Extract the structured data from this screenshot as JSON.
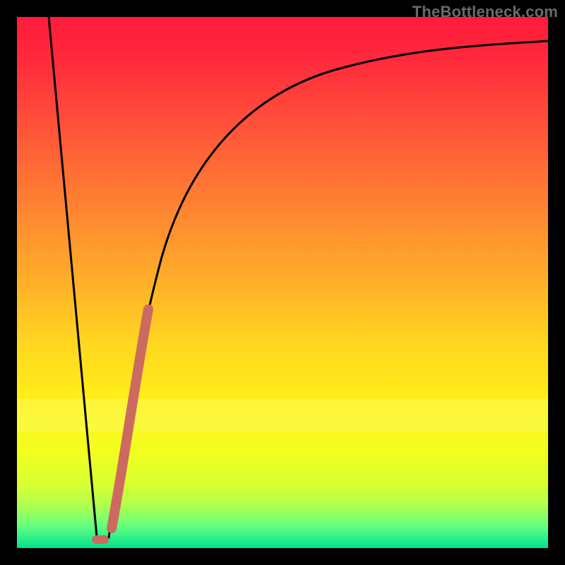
{
  "watermark": "TheBottleneck.com",
  "colors": {
    "background": "#000000",
    "curve": "#000000",
    "highlight": "#cc6a60"
  },
  "chart_data": {
    "type": "line",
    "title": "",
    "xlabel": "",
    "ylabel": "",
    "xlim": [
      0,
      100
    ],
    "ylim": [
      0,
      100
    ],
    "series": [
      {
        "name": "left-branch",
        "x": [
          5,
          8,
          11,
          14
        ],
        "values": [
          100,
          60,
          25,
          2
        ]
      },
      {
        "name": "right-branch",
        "x": [
          14,
          17,
          20,
          24,
          30,
          38,
          48,
          60,
          75,
          90,
          100
        ],
        "values": [
          2,
          18,
          38,
          55,
          70,
          79,
          85,
          89,
          92,
          94,
          95
        ]
      }
    ],
    "highlight_segment": {
      "series": "right-branch",
      "x_range": [
        15.5,
        23
      ],
      "y_range": [
        3,
        48
      ]
    },
    "background_gradient": {
      "top": "#ff1a3c",
      "mid": "#ffd820",
      "bottom": "#00e090"
    }
  }
}
